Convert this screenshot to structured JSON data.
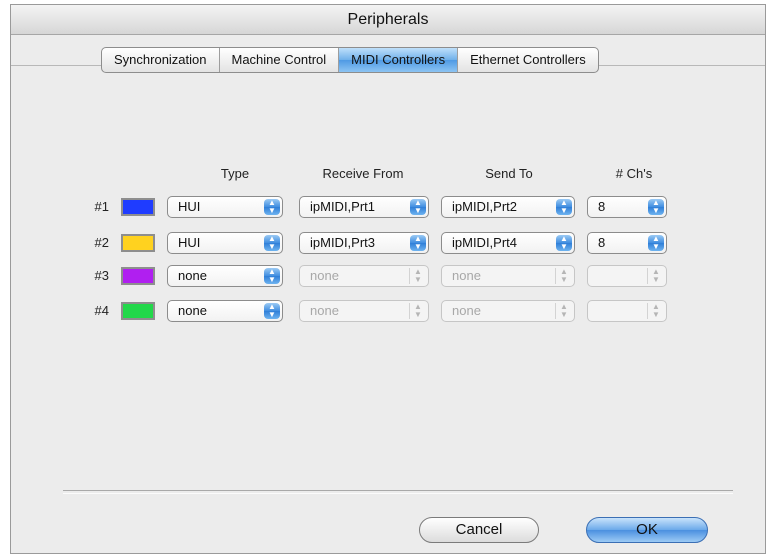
{
  "window": {
    "title": "Peripherals"
  },
  "tabs": [
    {
      "label": "Synchronization",
      "active": false
    },
    {
      "label": "Machine Control",
      "active": false
    },
    {
      "label": "MIDI Controllers",
      "active": true
    },
    {
      "label": "Ethernet Controllers",
      "active": false
    }
  ],
  "columns": {
    "type": "Type",
    "receive": "Receive From",
    "send": "Send To",
    "channels": "# Ch's"
  },
  "rows": [
    {
      "label": "#1",
      "color": "#1f3cff",
      "type": "HUI",
      "receive": "ipMIDI,Prt1",
      "send": "ipMIDI,Prt2",
      "channels": "8",
      "enabled": true
    },
    {
      "label": "#2",
      "color": "#ffd21f",
      "type": "HUI",
      "receive": "ipMIDI,Prt3",
      "send": "ipMIDI,Prt4",
      "channels": "8",
      "enabled": true
    },
    {
      "label": "#3",
      "color": "#b01ff0",
      "type": "none",
      "receive": "none",
      "send": "none",
      "channels": "",
      "enabled": false
    },
    {
      "label": "#4",
      "color": "#22d84a",
      "type": "none",
      "receive": "none",
      "send": "none",
      "channels": "",
      "enabled": false
    }
  ],
  "buttons": {
    "cancel": "Cancel",
    "ok": "OK"
  }
}
